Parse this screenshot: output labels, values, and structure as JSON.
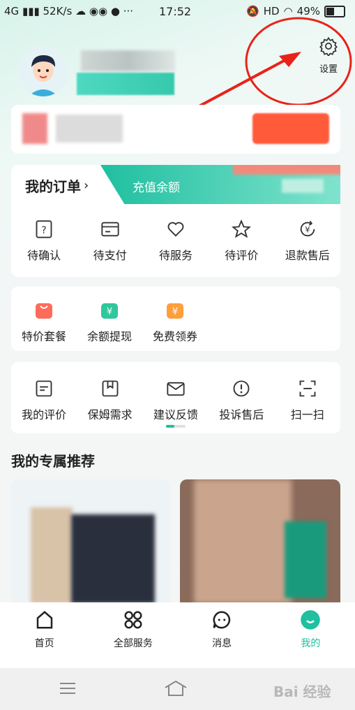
{
  "status": {
    "network": "4G",
    "speed": "52K/s",
    "time": "17:52",
    "hd": "HD",
    "battery": "49%"
  },
  "profile": {
    "settings_label": "设置"
  },
  "orders": {
    "title": "我的订单",
    "recharge_label": "充值余额",
    "items": [
      {
        "label": "待确认",
        "icon": "question-icon"
      },
      {
        "label": "待支付",
        "icon": "card-icon"
      },
      {
        "label": "待服务",
        "icon": "heart-icon"
      },
      {
        "label": "待评价",
        "icon": "star-icon"
      },
      {
        "label": "退款售后",
        "icon": "refund-yen-icon"
      }
    ]
  },
  "perks": {
    "items": [
      {
        "label": "特价套餐",
        "icon": "bag-icon",
        "color": "#ff6b5b"
      },
      {
        "label": "余额提现",
        "icon": "wallet-icon",
        "color": "#2fc79b"
      },
      {
        "label": "免费领券",
        "icon": "coupon-icon",
        "color": "#ff9f3c"
      }
    ]
  },
  "tools": {
    "items": [
      {
        "label": "我的评价",
        "icon": "comment-icon"
      },
      {
        "label": "保姆需求",
        "icon": "bookmark-icon"
      },
      {
        "label": "建议反馈",
        "icon": "mail-icon"
      },
      {
        "label": "投诉售后",
        "icon": "alert-icon"
      },
      {
        "label": "扫一扫",
        "icon": "scan-icon"
      }
    ]
  },
  "recommend": {
    "title": "我的专属推荐"
  },
  "tabs": [
    {
      "label": "首页",
      "icon": "home-icon"
    },
    {
      "label": "全部服务",
      "icon": "grid-icon"
    },
    {
      "label": "消息",
      "icon": "message-icon"
    },
    {
      "label": "我的",
      "icon": "me-icon",
      "active": true
    }
  ],
  "colors": {
    "accent": "#1fbfa0",
    "active_tab": "#1fbfa0",
    "annotation": "#e8231a"
  },
  "watermark": "Bai 经验"
}
